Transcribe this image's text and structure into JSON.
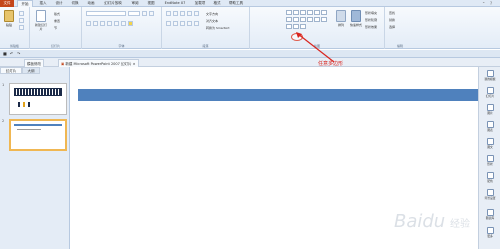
{
  "ribbon": {
    "tabs": [
      "文件",
      "开始",
      "插入",
      "设计",
      "切换",
      "动画",
      "幻灯片放映",
      "审阅",
      "视图",
      "EndNote X7",
      "加载项",
      "格式",
      "帮助工具"
    ],
    "groups": {
      "clipboard": {
        "label": "剪贴板",
        "paste": "粘贴"
      },
      "slides": {
        "label": "幻灯片",
        "new_slide": "新建幻灯片",
        "layout": "版式",
        "reset": "重置",
        "section": "节"
      },
      "font": {
        "label": "字体"
      },
      "paragraph": {
        "label": "段落",
        "text_direction": "文字方向",
        "align_text": "对齐文本",
        "smartart": "转换为 SmartArt"
      },
      "drawing": {
        "label": "绘图",
        "arrange": "排列",
        "quick_styles": "快速样式",
        "shape_fill": "形状填充",
        "shape_outline": "形状轮廓",
        "shape_effects": "形状效果"
      },
      "editing": {
        "label": "编辑",
        "find": "查找",
        "replace": "替换",
        "select": "选择"
      }
    }
  },
  "doc_tabs": [
    "模板修改",
    "新建 Microsoft PowerPoint 2007 幻灯片"
  ],
  "left_pane": {
    "tabs": [
      "幻灯片",
      "大纲"
    ],
    "slides": [
      "1",
      "2"
    ]
  },
  "right_pane": {
    "items": [
      "我的模板",
      "幻灯片",
      "图片",
      "图表",
      "图文",
      "形状",
      "配色",
      "背景设置",
      "图表库",
      "更多"
    ]
  },
  "annotation": {
    "text": "任意多边形"
  },
  "watermark": {
    "text": "Baidu经验"
  },
  "colors": {
    "accent": "#4f81bd",
    "file_tab": "#c4461a",
    "annotation": "#d9251f"
  }
}
